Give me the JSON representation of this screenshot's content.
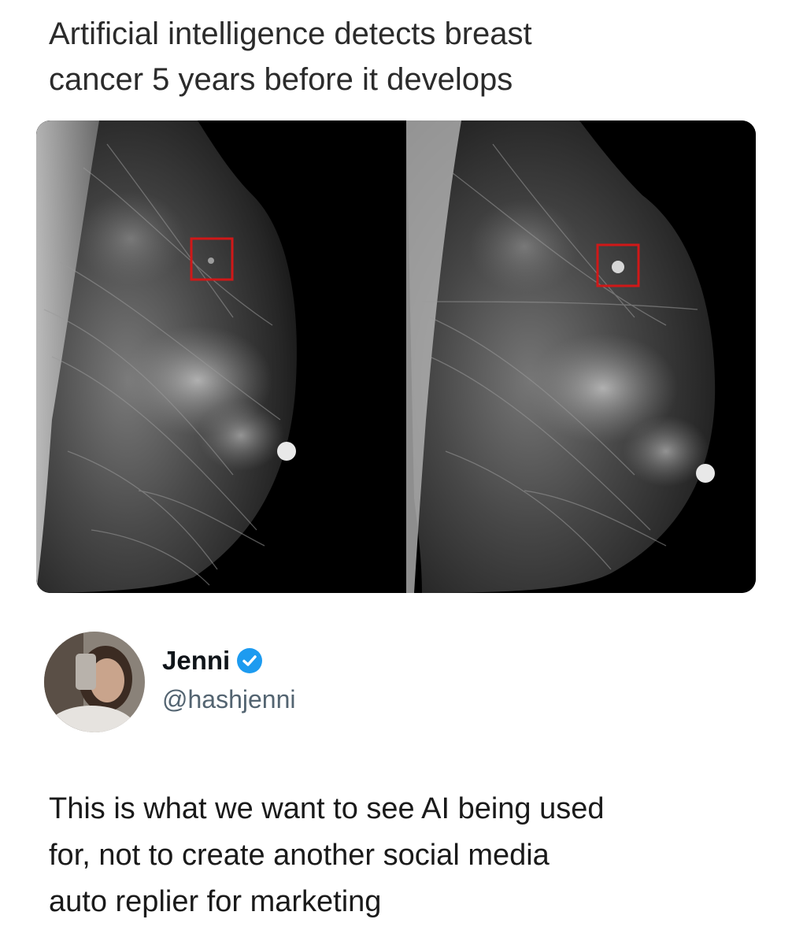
{
  "headline": {
    "line1": "Artificial intelligence detects breast",
    "line2": "cancer 5 years before it develops"
  },
  "media": {
    "icon": "mammogram-comparison-image",
    "highlight_color": "#d01818"
  },
  "author": {
    "display_name": "Jenni",
    "handle": "@hashjenni",
    "verified": true,
    "verified_color": "#1d9bf0"
  },
  "post": {
    "line1": "This is what we want to see AI being used",
    "line2": "for, not to create another social media",
    "line3": "auto replier for marketing"
  }
}
